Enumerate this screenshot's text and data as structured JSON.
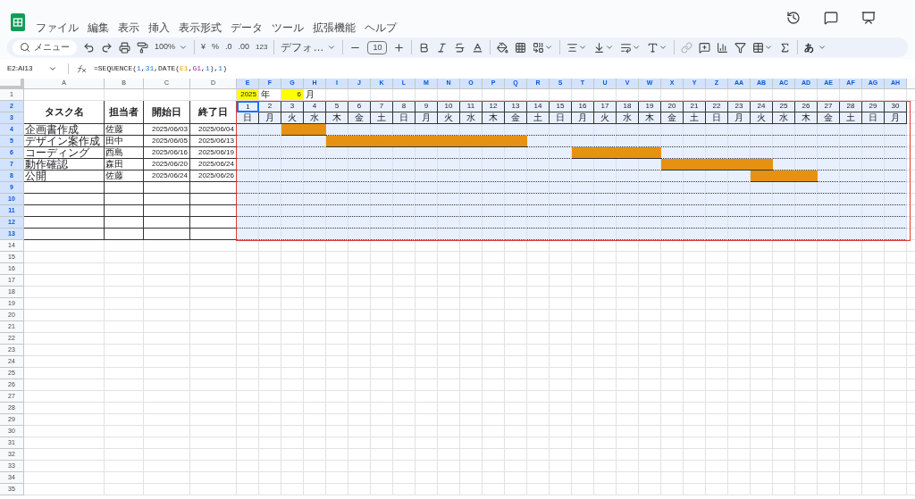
{
  "menu": [
    "ファイル",
    "編集",
    "表示",
    "挿入",
    "表示形式",
    "データ",
    "ツール",
    "拡張機能",
    "ヘルプ"
  ],
  "toolbar": {
    "search": "メニュー",
    "zoom": "100%",
    "currency": "¥",
    "percent": "%",
    "decrease_decimal": ".0",
    "increase_decimal": ".00",
    "number_format": "123",
    "font": "デフォ…",
    "font_size": "10",
    "input_mode": "あ"
  },
  "formula_bar": {
    "name_box": "E2:AI13",
    "formula": [
      {
        "text": "=SEQUENCE(",
        "kind": "plain"
      },
      {
        "text": "1",
        "kind": "number"
      },
      {
        "text": ",",
        "kind": "plain"
      },
      {
        "text": "31",
        "kind": "number"
      },
      {
        "text": ",DATE(",
        "kind": "plain"
      },
      {
        "text": "E1",
        "kind": "ref"
      },
      {
        "text": ",",
        "kind": "plain"
      },
      {
        "text": "G1",
        "kind": "ref2"
      },
      {
        "text": ",",
        "kind": "plain"
      },
      {
        "text": "1",
        "kind": "number"
      },
      {
        "text": "),",
        "kind": "plain"
      },
      {
        "text": "1",
        "kind": "number"
      },
      {
        "text": ")",
        "kind": "plain"
      }
    ]
  },
  "sheet": {
    "columns": [
      {
        "label": "A",
        "selected": false
      },
      {
        "label": "B",
        "selected": false
      },
      {
        "label": "C",
        "selected": false
      },
      {
        "label": "D",
        "selected": false
      },
      {
        "label": "E",
        "selected": true
      },
      {
        "label": "F",
        "selected": true
      },
      {
        "label": "G",
        "selected": true
      },
      {
        "label": "H",
        "selected": true
      },
      {
        "label": "I",
        "selected": true
      },
      {
        "label": "J",
        "selected": true
      },
      {
        "label": "K",
        "selected": true
      },
      {
        "label": "L",
        "selected": true
      },
      {
        "label": "M",
        "selected": true
      },
      {
        "label": "N",
        "selected": true
      },
      {
        "label": "O",
        "selected": true
      },
      {
        "label": "P",
        "selected": true
      },
      {
        "label": "Q",
        "selected": true
      },
      {
        "label": "R",
        "selected": true
      },
      {
        "label": "S",
        "selected": true
      },
      {
        "label": "T",
        "selected": true
      },
      {
        "label": "U",
        "selected": true
      },
      {
        "label": "V",
        "selected": true
      },
      {
        "label": "W",
        "selected": true
      },
      {
        "label": "X",
        "selected": true
      },
      {
        "label": "Y",
        "selected": true
      },
      {
        "label": "Z",
        "selected": true
      },
      {
        "label": "AA",
        "selected": true
      },
      {
        "label": "AB",
        "selected": true
      },
      {
        "label": "AC",
        "selected": true
      },
      {
        "label": "AD",
        "selected": true
      },
      {
        "label": "AE",
        "selected": true
      },
      {
        "label": "AF",
        "selected": true
      },
      {
        "label": "AG",
        "selected": true
      },
      {
        "label": "AH",
        "selected": true
      }
    ],
    "rows": [
      {
        "label": "1",
        "selected": false
      },
      {
        "label": "2",
        "selected": true
      },
      {
        "label": "3",
        "selected": true
      },
      {
        "label": "4",
        "selected": true
      },
      {
        "label": "5",
        "selected": true
      },
      {
        "label": "6",
        "selected": true
      },
      {
        "label": "7",
        "selected": true
      },
      {
        "label": "8",
        "selected": true
      },
      {
        "label": "9",
        "selected": true
      },
      {
        "label": "10",
        "selected": true
      },
      {
        "label": "11",
        "selected": true
      },
      {
        "label": "12",
        "selected": true
      },
      {
        "label": "13",
        "selected": true
      },
      {
        "label": "14",
        "selected": false
      },
      {
        "label": "15",
        "selected": false
      },
      {
        "label": "16",
        "selected": false
      },
      {
        "label": "17",
        "selected": false
      },
      {
        "label": "18",
        "selected": false
      },
      {
        "label": "19",
        "selected": false
      },
      {
        "label": "20",
        "selected": false
      },
      {
        "label": "21",
        "selected": false
      },
      {
        "label": "22",
        "selected": false
      },
      {
        "label": "23",
        "selected": false
      },
      {
        "label": "24",
        "selected": false
      },
      {
        "label": "25",
        "selected": false
      },
      {
        "label": "26",
        "selected": false
      },
      {
        "label": "27",
        "selected": false
      },
      {
        "label": "28",
        "selected": false
      },
      {
        "label": "29",
        "selected": false
      },
      {
        "label": "30",
        "selected": false
      },
      {
        "label": "31",
        "selected": false
      },
      {
        "label": "32",
        "selected": false
      },
      {
        "label": "33",
        "selected": false
      },
      {
        "label": "34",
        "selected": false
      },
      {
        "label": "35",
        "selected": false
      }
    ],
    "year": "2025",
    "year_suffix": "年",
    "month": "6",
    "month_suffix": "月",
    "headers": [
      "タスク名",
      "担当者",
      "開始日",
      "終了日"
    ],
    "days": [
      {
        "day": "1",
        "weekday": "日",
        "active": true
      },
      {
        "day": "2",
        "weekday": "月",
        "active": false
      },
      {
        "day": "3",
        "weekday": "火",
        "active": false
      },
      {
        "day": "4",
        "weekday": "水",
        "active": false
      },
      {
        "day": "5",
        "weekday": "木",
        "active": false
      },
      {
        "day": "6",
        "weekday": "金",
        "active": false
      },
      {
        "day": "7",
        "weekday": "土",
        "active": false
      },
      {
        "day": "8",
        "weekday": "日",
        "active": false
      },
      {
        "day": "9",
        "weekday": "月",
        "active": false
      },
      {
        "day": "10",
        "weekday": "火",
        "active": false
      },
      {
        "day": "11",
        "weekday": "水",
        "active": false
      },
      {
        "day": "12",
        "weekday": "木",
        "active": false
      },
      {
        "day": "13",
        "weekday": "金",
        "active": false
      },
      {
        "day": "14",
        "weekday": "土",
        "active": false
      },
      {
        "day": "15",
        "weekday": "日",
        "active": false
      },
      {
        "day": "16",
        "weekday": "月",
        "active": false
      },
      {
        "day": "17",
        "weekday": "火",
        "active": false
      },
      {
        "day": "18",
        "weekday": "水",
        "active": false
      },
      {
        "day": "19",
        "weekday": "木",
        "active": false
      },
      {
        "day": "20",
        "weekday": "金",
        "active": false
      },
      {
        "day": "21",
        "weekday": "土",
        "active": false
      },
      {
        "day": "22",
        "weekday": "日",
        "active": false
      },
      {
        "day": "23",
        "weekday": "月",
        "active": false
      },
      {
        "day": "24",
        "weekday": "火",
        "active": false
      },
      {
        "day": "25",
        "weekday": "水",
        "active": false
      },
      {
        "day": "26",
        "weekday": "木",
        "active": false
      },
      {
        "day": "27",
        "weekday": "金",
        "active": false
      },
      {
        "day": "28",
        "weekday": "土",
        "active": false
      },
      {
        "day": "29",
        "weekday": "日",
        "active": false
      },
      {
        "day": "30",
        "weekday": "月",
        "active": false
      }
    ],
    "tasks": [
      {
        "name": "企画書作成",
        "assignee": "佐藤",
        "start": "2025/06/03",
        "end": "2025/06/04",
        "filled": [
          false,
          false,
          true,
          true,
          false,
          false,
          false,
          false,
          false,
          false,
          false,
          false,
          false,
          false,
          false,
          false,
          false,
          false,
          false,
          false,
          false,
          false,
          false,
          false,
          false,
          false,
          false,
          false,
          false,
          false
        ]
      },
      {
        "name": "デザイン案作成",
        "assignee": "田中",
        "start": "2025/06/05",
        "end": "2025/06/13",
        "filled": [
          false,
          false,
          false,
          false,
          true,
          true,
          true,
          true,
          true,
          true,
          true,
          true,
          true,
          false,
          false,
          false,
          false,
          false,
          false,
          false,
          false,
          false,
          false,
          false,
          false,
          false,
          false,
          false,
          false,
          false
        ]
      },
      {
        "name": "コーディング",
        "assignee": "西島",
        "start": "2025/06/16",
        "end": "2025/06/19",
        "filled": [
          false,
          false,
          false,
          false,
          false,
          false,
          false,
          false,
          false,
          false,
          false,
          false,
          false,
          false,
          false,
          true,
          true,
          true,
          true,
          false,
          false,
          false,
          false,
          false,
          false,
          false,
          false,
          false,
          false,
          false
        ]
      },
      {
        "name": "動作確認",
        "assignee": "森田",
        "start": "2025/06/20",
        "end": "2025/06/24",
        "filled": [
          false,
          false,
          false,
          false,
          false,
          false,
          false,
          false,
          false,
          false,
          false,
          false,
          false,
          false,
          false,
          false,
          false,
          false,
          false,
          true,
          true,
          true,
          true,
          true,
          false,
          false,
          false,
          false,
          false,
          false
        ]
      },
      {
        "name": "公開",
        "assignee": "佐藤",
        "start": "2025/06/24",
        "end": "2025/06/26",
        "filled": [
          false,
          false,
          false,
          false,
          false,
          false,
          false,
          false,
          false,
          false,
          false,
          false,
          false,
          false,
          false,
          false,
          false,
          false,
          false,
          false,
          false,
          false,
          false,
          true,
          true,
          true,
          false,
          false,
          false,
          false
        ]
      }
    ]
  }
}
